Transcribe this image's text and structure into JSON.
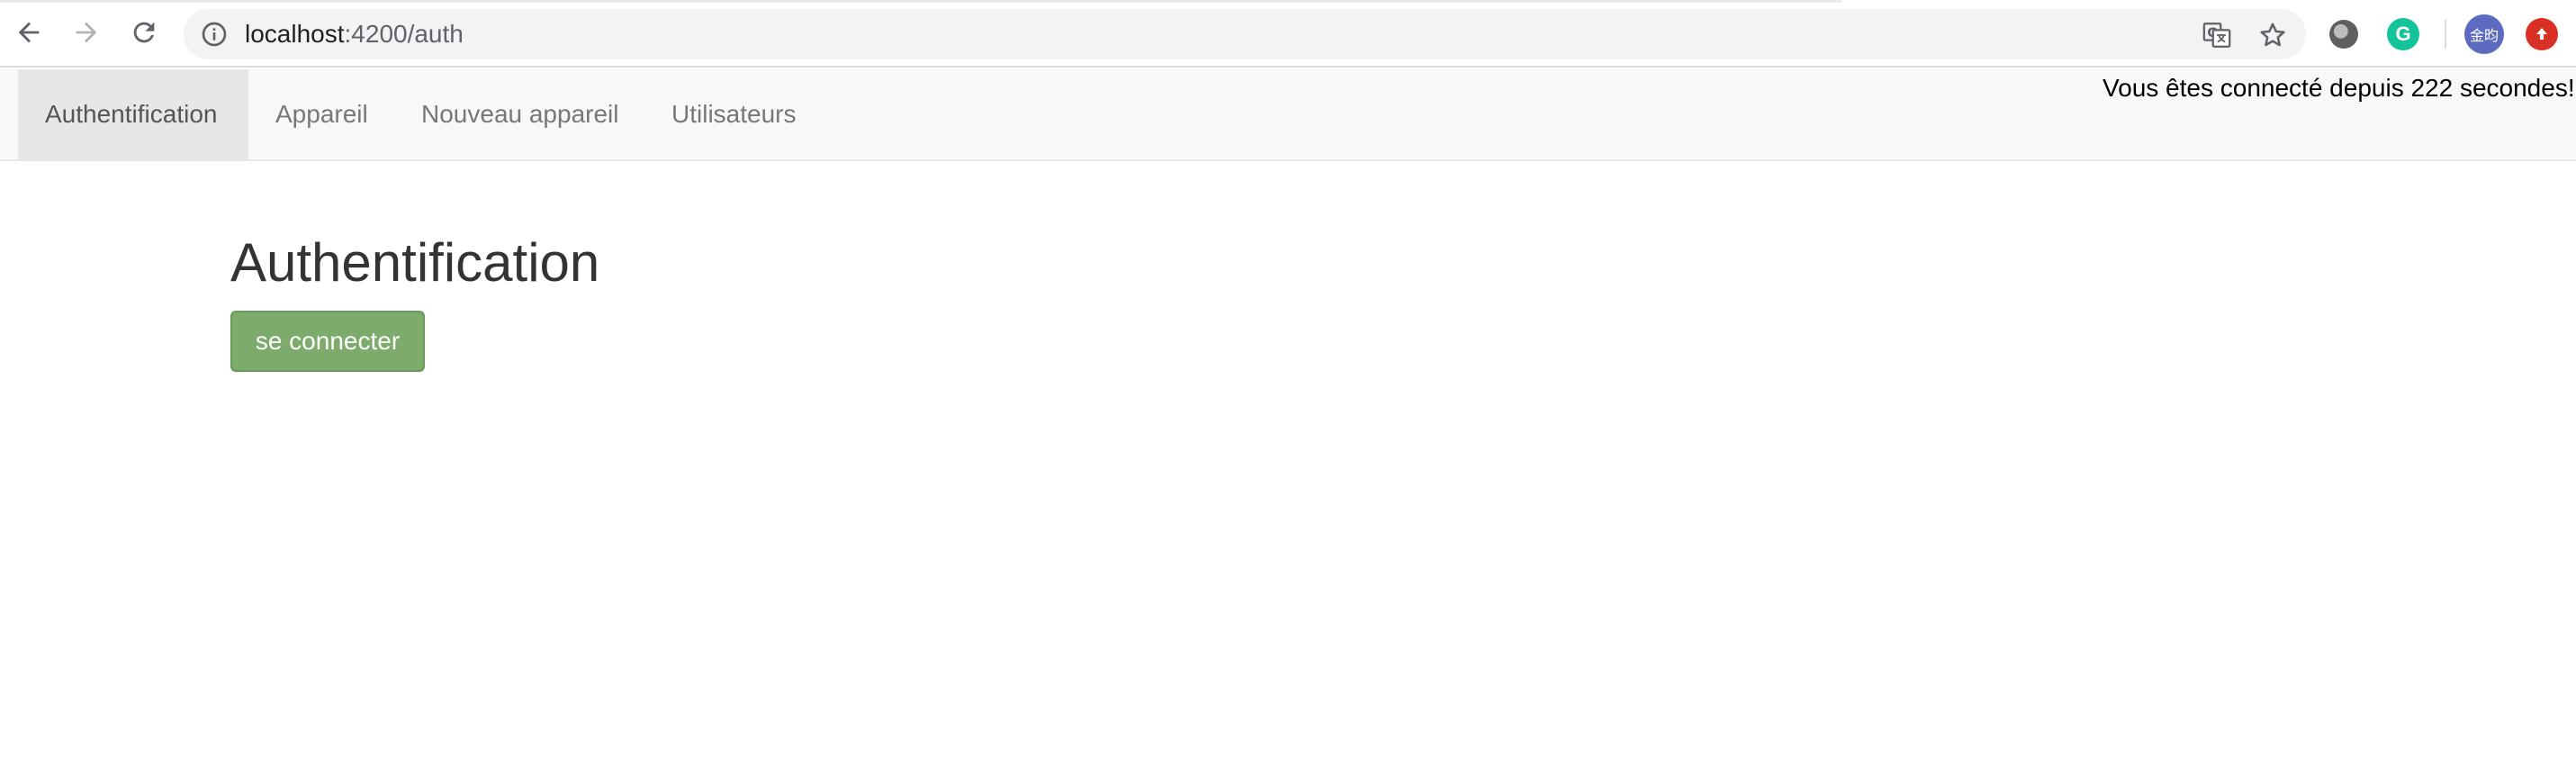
{
  "browser": {
    "url_host": "localhost",
    "url_path": ":4200/auth",
    "icons": {
      "back": "arrow-left-icon",
      "forward": "arrow-right-icon",
      "reload": "reload-icon",
      "site_info": "info-icon",
      "translate": "translate-icon",
      "bookmark": "star-icon",
      "extension_1": "dark-reader-icon",
      "extension_2": "grammarly-icon",
      "extension_3": "avatar-icon",
      "extension_4": "upload-icon"
    },
    "grammarly_letter": "G",
    "avatar_text": "金昀"
  },
  "navbar": {
    "tabs": [
      {
        "label": "Authentification",
        "active": true
      },
      {
        "label": "Appareil",
        "active": false
      },
      {
        "label": "Nouveau appareil",
        "active": false
      },
      {
        "label": "Utilisateurs",
        "active": false
      }
    ],
    "connected_status": "Vous êtes connecté depuis 222 secondes!"
  },
  "main": {
    "title": "Authentification",
    "connect_button": "se connecter"
  },
  "colors": {
    "navbar_bg": "#f8f8f8",
    "active_tab_bg": "#e7e7e7",
    "button_success": "#7dab6b",
    "title_text": "#333333"
  }
}
